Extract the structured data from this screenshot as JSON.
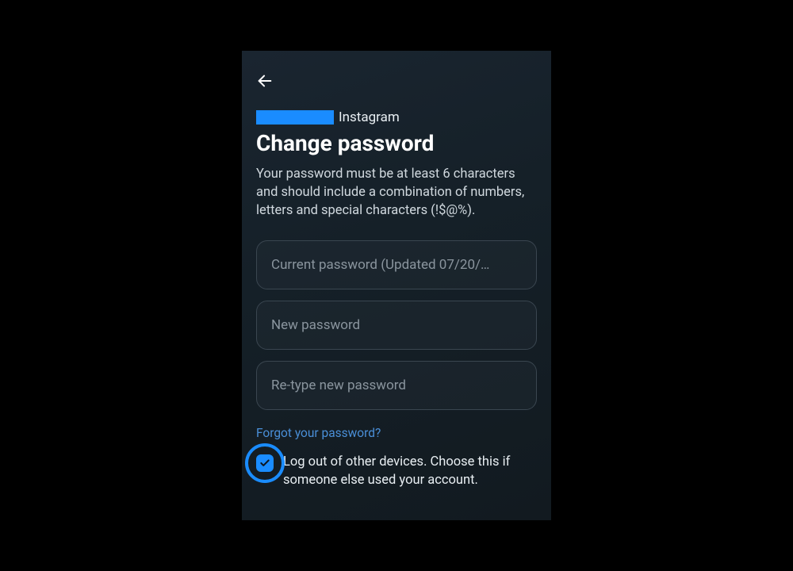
{
  "header": {
    "account_suffix": "Instagram",
    "title": "Change password",
    "description": "Your password must be at least 6 characters and should include a combination of numbers, letters and special characters (!$@%)."
  },
  "fields": {
    "current_placeholder": "Current password (Updated 07/20/…",
    "new_placeholder": "New password",
    "retype_placeholder": "Re-type new password"
  },
  "links": {
    "forgot": "Forgot your password?"
  },
  "checkbox": {
    "label": "Log out of other devices. Choose this if someone else used your account.",
    "checked": true
  }
}
